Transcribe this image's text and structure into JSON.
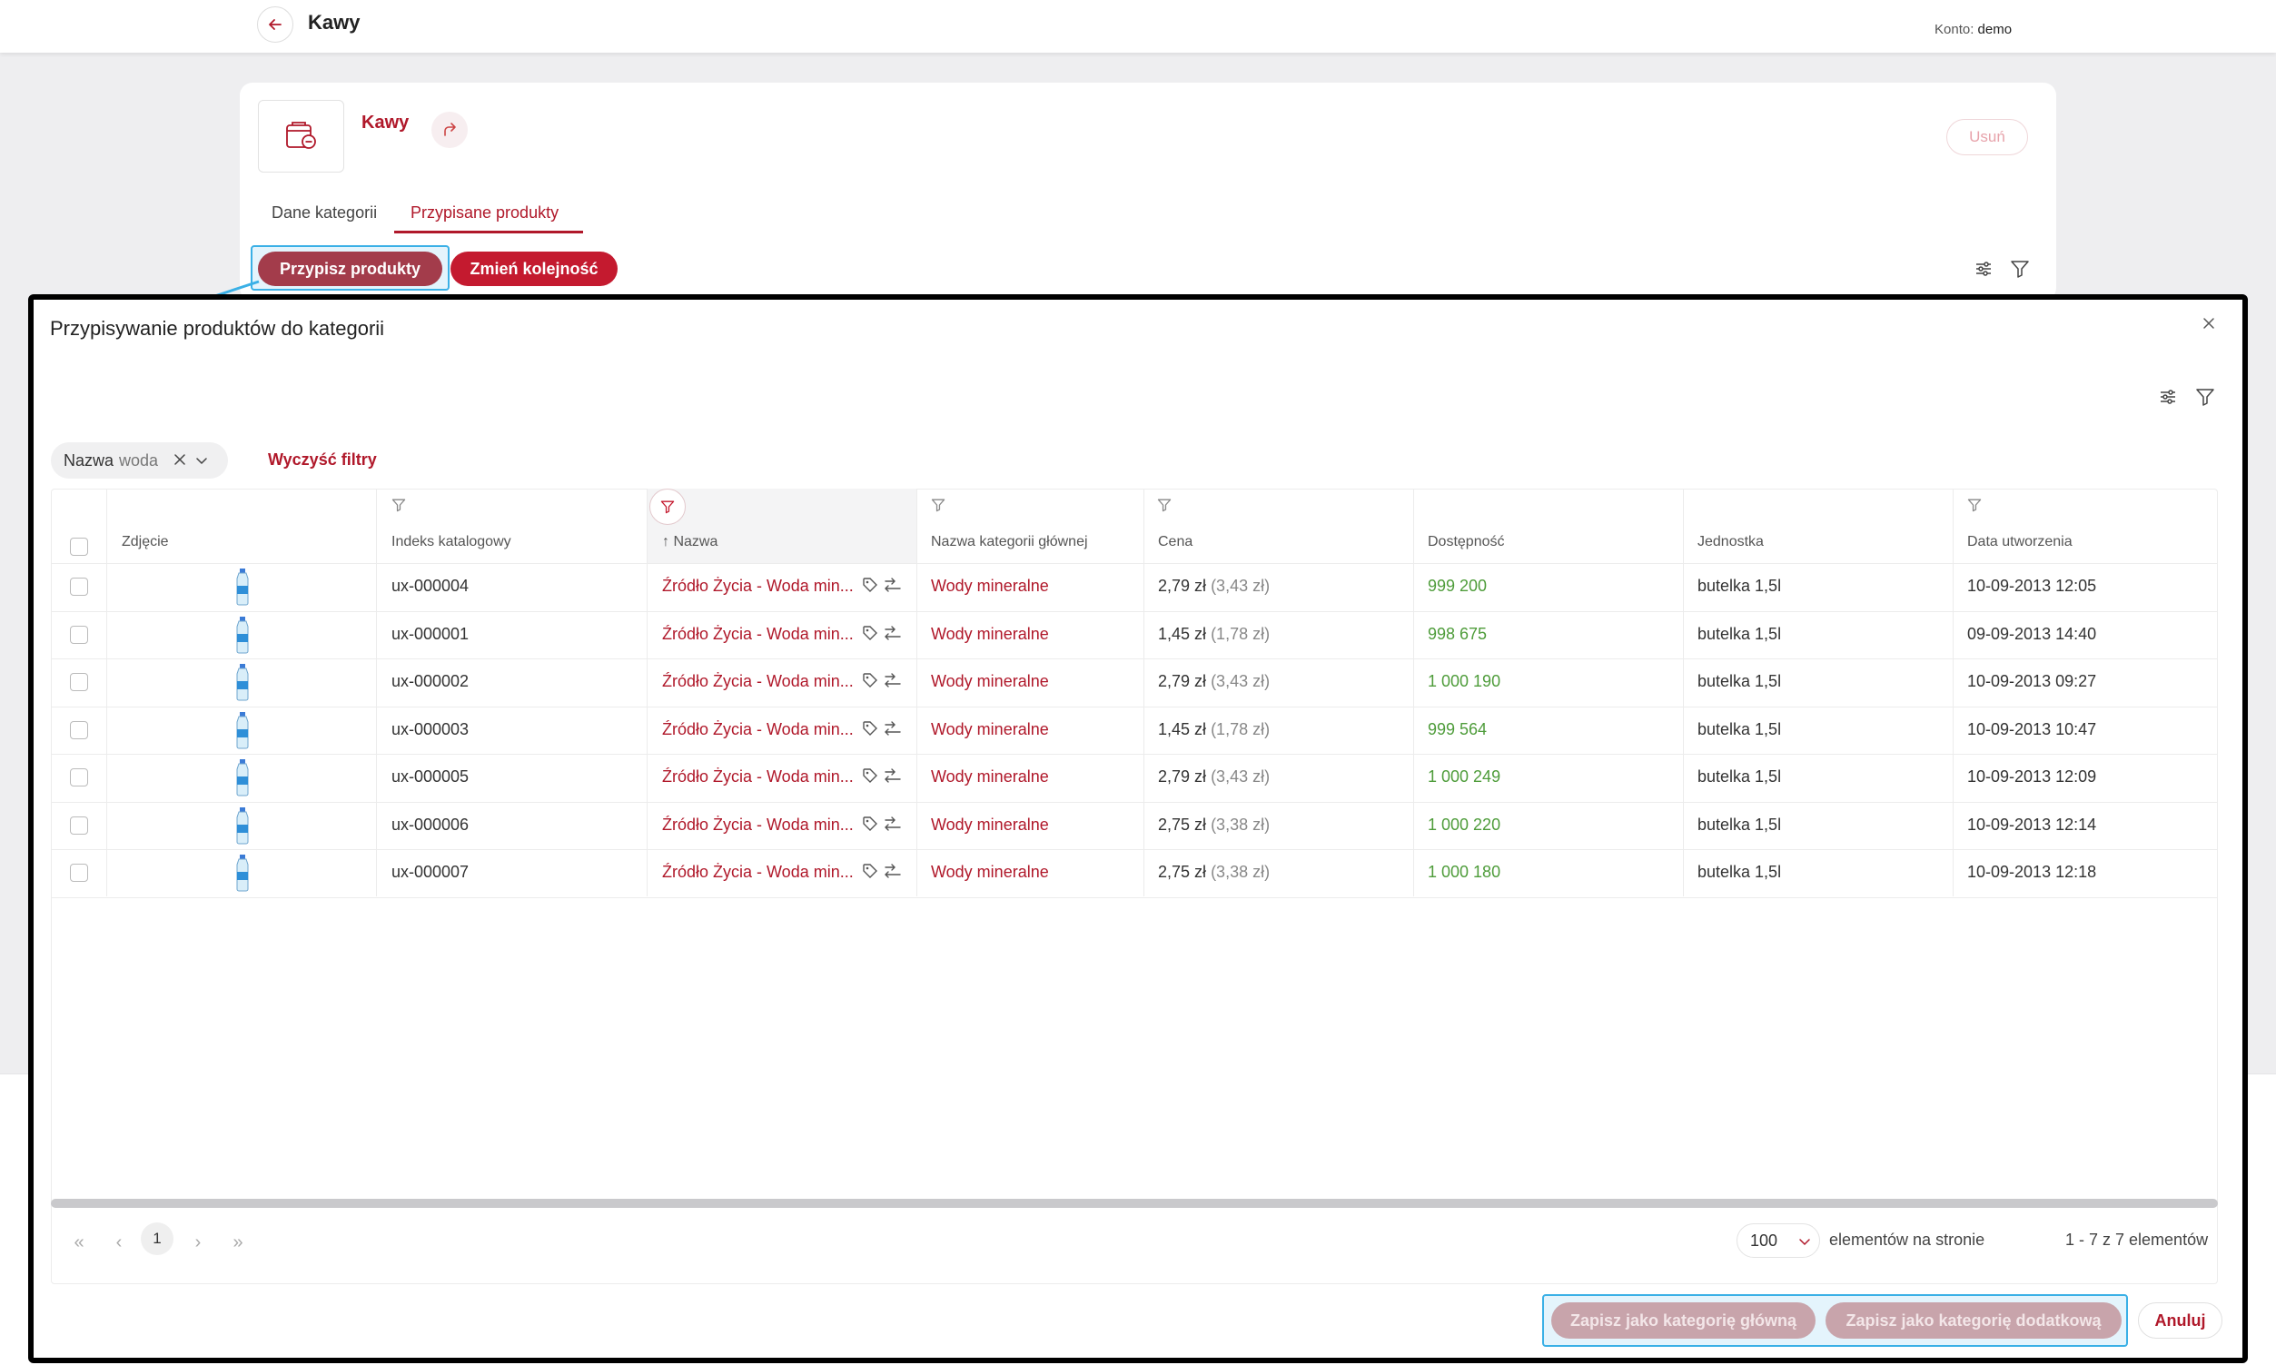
{
  "header": {
    "title": "Kawy",
    "account_label": "Konto:",
    "account_value": "demo"
  },
  "category": {
    "name": "Kawy",
    "delete_label": "Usuń",
    "tabs": [
      {
        "label": "Dane kategorii"
      },
      {
        "label": "Przypisane produkty"
      }
    ],
    "assign_label": "Przypisz produkty",
    "reorder_label": "Zmień kolejność"
  },
  "modal": {
    "title": "Przypisywanie produktów do kategorii",
    "filter_chip": {
      "field": "Nazwa",
      "value": "woda"
    },
    "clear_filters": "Wyczyść filtry",
    "columns": [
      "Zdjęcie",
      "Indeks katalogowy",
      "↑ Nazwa",
      "Nazwa kategorii głównej",
      "Cena",
      "Dostępność",
      "Jednostka",
      "Data utworzenia"
    ],
    "rows": [
      {
        "index": "ux-000004",
        "name": "Źródło Życia - Woda min...",
        "category": "Wody mineralne",
        "price": "2,79 zł",
        "price_gross": "(3,43 zł)",
        "availability": "999 200",
        "unit": "butelka 1,5l",
        "created": "10-09-2013 12:05"
      },
      {
        "index": "ux-000001",
        "name": "Źródło Życia - Woda min...",
        "category": "Wody mineralne",
        "price": "1,45 zł",
        "price_gross": "(1,78 zł)",
        "availability": "998 675",
        "unit": "butelka 1,5l",
        "created": "09-09-2013 14:40"
      },
      {
        "index": "ux-000002",
        "name": "Źródło Życia - Woda min...",
        "category": "Wody mineralne",
        "price": "2,79 zł",
        "price_gross": "(3,43 zł)",
        "availability": "1 000 190",
        "unit": "butelka 1,5l",
        "created": "10-09-2013 09:27"
      },
      {
        "index": "ux-000003",
        "name": "Źródło Życia - Woda min...",
        "category": "Wody mineralne",
        "price": "1,45 zł",
        "price_gross": "(1,78 zł)",
        "availability": "999 564",
        "unit": "butelka 1,5l",
        "created": "10-09-2013 10:47"
      },
      {
        "index": "ux-000005",
        "name": "Źródło Życia - Woda min...",
        "category": "Wody mineralne",
        "price": "2,79 zł",
        "price_gross": "(3,43 zł)",
        "availability": "1 000 249",
        "unit": "butelka 1,5l",
        "created": "10-09-2013 12:09"
      },
      {
        "index": "ux-000006",
        "name": "Źródło Życia - Woda min...",
        "category": "Wody mineralne",
        "price": "2,75 zł",
        "price_gross": "(3,38 zł)",
        "availability": "1 000 220",
        "unit": "butelka 1,5l",
        "created": "10-09-2013 12:14"
      },
      {
        "index": "ux-000007",
        "name": "Źródło Życia - Woda min...",
        "category": "Wody mineralne",
        "price": "2,75 zł",
        "price_gross": "(3,38 zł)",
        "availability": "1 000 180",
        "unit": "butelka 1,5l",
        "created": "10-09-2013 12:18"
      }
    ],
    "pagination": {
      "current_page": "1",
      "per_page": "100",
      "per_page_label": "elementów na stronie",
      "range": "1 - 7 z 7 elementów"
    },
    "footer": {
      "save_main": "Zapisz jako kategorię główną",
      "save_extra": "Zapisz jako kategorię dodatkową",
      "cancel": "Anuluj"
    }
  },
  "colors": {
    "accent": "#b0182a",
    "assign_button": "#a33c4b",
    "availability": "#4e9c3a",
    "highlight": "#3ab0e6"
  },
  "icons": {
    "back": "arrow-left-icon",
    "category": "category-icon",
    "share": "share-icon",
    "settings": "sliders-icon",
    "filter": "filter-icon",
    "close": "close-icon",
    "product": "water-bottle-icon",
    "tag": "tag-icon",
    "assign": "assign-icon"
  }
}
